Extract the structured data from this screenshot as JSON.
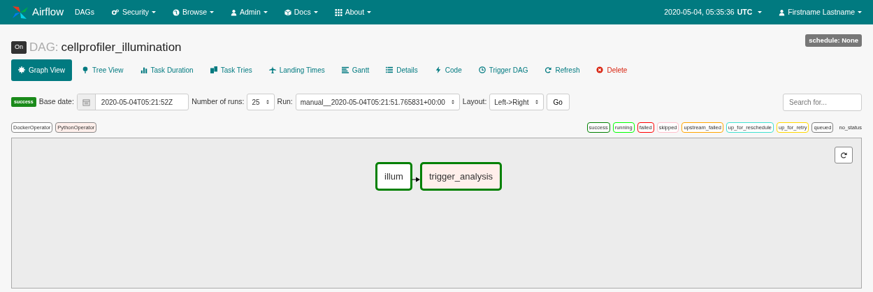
{
  "navbar": {
    "brand": "Airflow",
    "items": [
      {
        "label": "DAGs",
        "dropdown": false
      },
      {
        "label": "Security",
        "dropdown": true
      },
      {
        "label": "Browse",
        "dropdown": true
      },
      {
        "label": "Admin",
        "dropdown": true
      },
      {
        "label": "Docs",
        "dropdown": true
      },
      {
        "label": "About",
        "dropdown": true
      }
    ],
    "clock": "2020-05-04, 05:35:36",
    "timezone": "UTC",
    "user": "Firstname Lastname"
  },
  "dag": {
    "toggle": "On",
    "on": true,
    "prefix": "DAG:",
    "name": "cellprofiler_illumination",
    "schedule": "schedule: None"
  },
  "tabs": [
    {
      "label": "Graph View",
      "selected": true
    },
    {
      "label": "Tree View",
      "selected": false
    },
    {
      "label": "Task Duration",
      "selected": false
    },
    {
      "label": "Task Tries",
      "selected": false
    },
    {
      "label": "Landing Times",
      "selected": false
    },
    {
      "label": "Gantt",
      "selected": false
    },
    {
      "label": "Details",
      "selected": false
    },
    {
      "label": "Code",
      "selected": false
    },
    {
      "label": "Trigger DAG",
      "selected": false
    },
    {
      "label": "Refresh",
      "selected": false
    },
    {
      "label": "Delete",
      "selected": false
    }
  ],
  "form": {
    "status": "success",
    "base_date_label": "Base date:",
    "base_date": "2020-05-04T05:21:52Z",
    "runs_label": "Number of runs:",
    "runs": "25",
    "run_label": "Run:",
    "run": "manual__2020-05-04T05:21:51.765831+00:00",
    "layout_label": "Layout:",
    "layout": "Left->Right",
    "go": "Go",
    "search_placeholder": "Search for..."
  },
  "operators": [
    {
      "label": "DockerOperator",
      "color": "#ffffff"
    },
    {
      "label": "PythonOperator",
      "color": "#ffefeb"
    }
  ],
  "legend": [
    {
      "label": "success",
      "color": "#008000"
    },
    {
      "label": "running",
      "color": "#00ff00"
    },
    {
      "label": "failed",
      "color": "#ff0000"
    },
    {
      "label": "skipped",
      "color": "#ffc0cb"
    },
    {
      "label": "upstream_failed",
      "color": "#ffa500"
    },
    {
      "label": "up_for_reschedule",
      "color": "#40e0d0"
    },
    {
      "label": "up_for_retry",
      "color": "#ffd700"
    },
    {
      "label": "queued",
      "color": "#808080"
    },
    {
      "label": "no_status"
    }
  ],
  "graph": {
    "nodes": [
      {
        "label": "illum",
        "kind": "docker",
        "color": "#008000"
      },
      {
        "label": "trigger_analysis",
        "kind": "python",
        "color": "#008000"
      }
    ]
  }
}
